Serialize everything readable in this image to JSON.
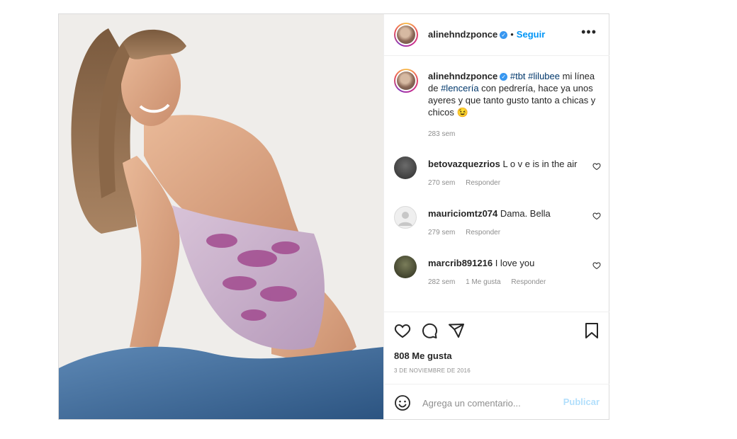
{
  "post": {
    "username": "alinehndzponce",
    "follow_label": "Seguir",
    "separator": "•",
    "more_label": "•••"
  },
  "caption": {
    "username": "alinehndzponce",
    "tag1": "#tbt",
    "tag2": "#lilubee",
    "text1": " mi línea de ",
    "tag3": "#lencería",
    "text2": " con pedrería, hace ya unos ayeres y que tanto gusto tanto a chicas y chicos 😉",
    "time": "283 sem"
  },
  "comments": [
    {
      "username": "betovazquezrios",
      "text": "L o v e is in the air",
      "time": "270 sem",
      "likes": "",
      "reply": "Responder"
    },
    {
      "username": "mauriciomtz074",
      "text": "Dama. Bella",
      "time": "279 sem",
      "likes": "",
      "reply": "Responder"
    },
    {
      "username": "marcrib891216",
      "text": "I love you",
      "time": "282 sem",
      "likes": "1 Me gusta",
      "reply": "Responder"
    }
  ],
  "actions": {
    "likes": "808 Me gusta",
    "date": "3 DE NOVIEMBRE DE 2016"
  },
  "add_comment": {
    "placeholder": "Agrega un comentario...",
    "publish_label": "Publicar"
  },
  "colors": {
    "accent": "#0095f6",
    "publish_disabled": "#b2dffc",
    "muted": "#8e8e8e",
    "hashtag": "#00376b"
  },
  "icons": [
    "verified-badge-icon",
    "more-options-icon",
    "heart-icon",
    "comment-icon",
    "share-icon",
    "bookmark-icon",
    "emoji-icon"
  ]
}
